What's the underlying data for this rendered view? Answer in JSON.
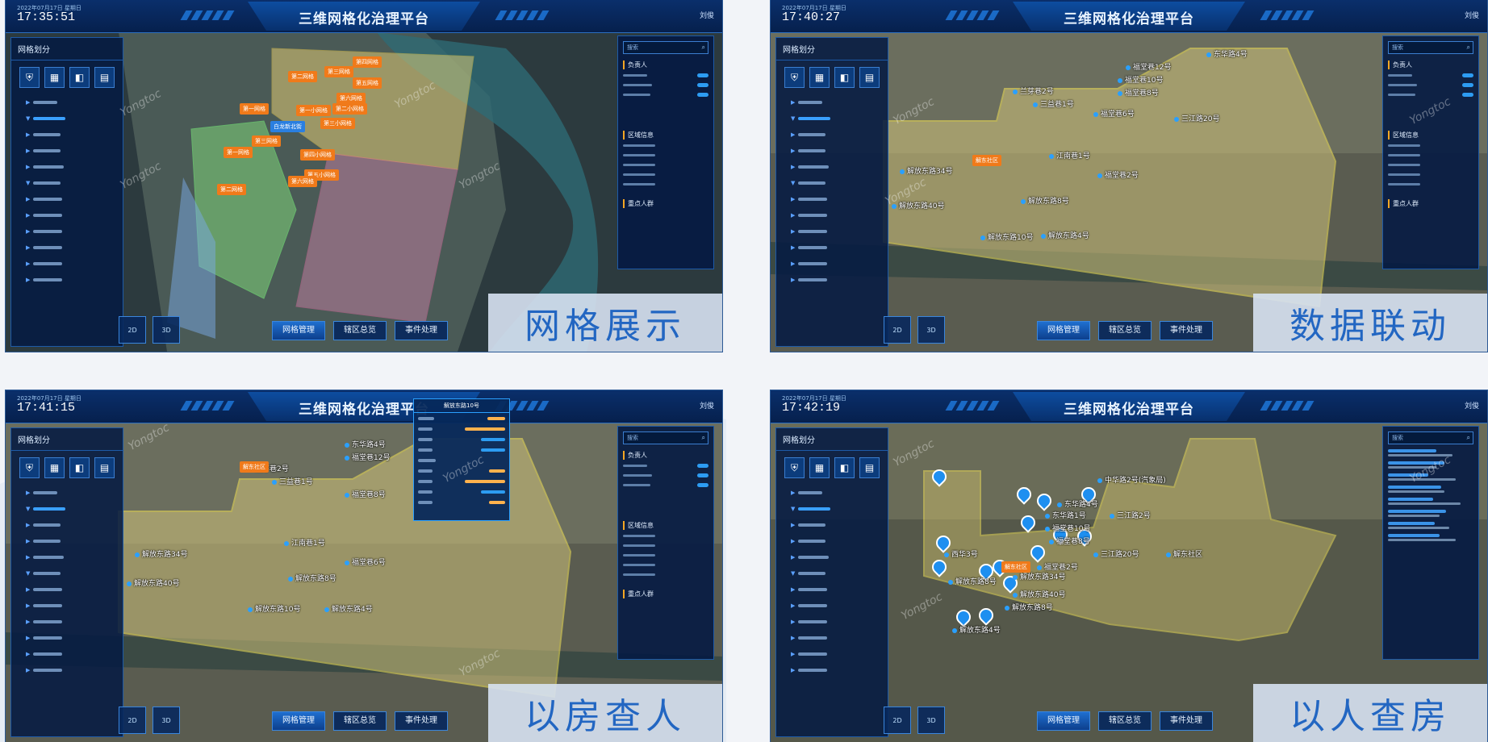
{
  "app": {
    "title": "三维网格化治理平台",
    "user": "刘俊",
    "date": "2022年07月17日 星期日"
  },
  "sidebar": {
    "title": "网格划分",
    "icons": [
      "shield-icon",
      "building-icon",
      "grid-icon",
      "table-grid-icon"
    ],
    "icon_glyphs": [
      "⛨",
      "▦",
      "◧",
      "▤"
    ]
  },
  "right_panel": {
    "search_placeholder": "搜索",
    "section_person": "负责人",
    "section_area": "区域信息",
    "section_key": "重点人群"
  },
  "bottom_buttons": [
    "网格管理",
    "辖区总览",
    "事件处理"
  ],
  "view_buttons": [
    "2D",
    "3D"
  ],
  "panels": [
    {
      "time": "17:35:51",
      "caption": "网格展示",
      "center_tag": "白龙新北街",
      "grid_tags": [
        "第一网格",
        "第二网格",
        "第三网格",
        "第四网格",
        "第五网格",
        "第六网格",
        "第一小网格",
        "第二小网格",
        "第三小网格",
        "第四小网格",
        "第五小网格",
        "第六网格",
        "第三网格",
        "第一网格",
        "第二网格"
      ]
    },
    {
      "time": "17:40:27",
      "caption": "数据联动",
      "area_tag": "解东社区",
      "labels": [
        "东华路4号",
        "福堂巷12号",
        "福堂巷10号",
        "福堂巷8号",
        "兰芽巷2号",
        "三益巷1号",
        "福堂巷6号",
        "三江路20号",
        "江南巷1号",
        "福堂巷2号",
        "解放东路34号",
        "解放东路8号",
        "解放东路40号",
        "解放东路10号",
        "解放东路4号",
        "解东社区"
      ]
    },
    {
      "time": "17:41:15",
      "caption": "以房查人",
      "area_tag": "解东社区",
      "popup_title": "解放东路10号",
      "labels": [
        "东华路4号",
        "福堂巷12号",
        "兰芽巷2号",
        "三益巷1号",
        "福堂巷8号",
        "江南巷1号",
        "福堂巷6号",
        "解放东路34号",
        "解放东路40号",
        "解放东路10号",
        "解放东路4号",
        "解放东路8号"
      ]
    },
    {
      "time": "17:42:19",
      "caption": "以人查房",
      "area_tag": "解东社区",
      "labels": [
        "中华路2号(汽象局)",
        "东华路4号",
        "三江路2号",
        "东华路1号",
        "福堂巷10号",
        "福堂巷8号",
        "三江路20号",
        "解东社区",
        "福堂巷2号",
        "西华3号",
        "解放东路8号",
        "解放东路34号",
        "解放东路40号",
        "解放东路8号",
        "解放东路4号"
      ]
    }
  ]
}
